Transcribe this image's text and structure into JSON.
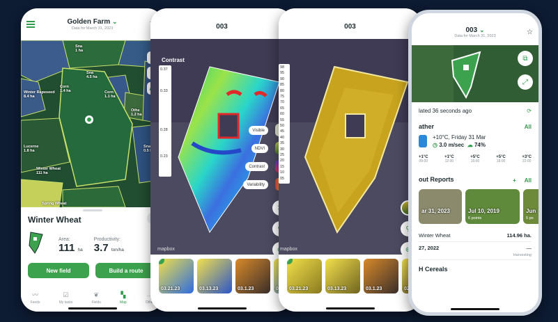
{
  "colors": {
    "accent": "#3da24e",
    "background": "#0d1b33"
  },
  "phone1": {
    "header": {
      "title": "Golden Farm",
      "subtitle": "Data for March 31, 2023"
    },
    "map_buttons": [
      "AR"
    ],
    "fields": [
      {
        "name": "Sna",
        "area": "1 ha"
      },
      {
        "name": "Winter Rapeseed",
        "area": "8.4 ha"
      },
      {
        "name": "Corn",
        "area": "1.1 ha"
      },
      {
        "name": "Corn",
        "area": "1.4 ha"
      },
      {
        "name": "Sna",
        "area": "4.5 ha"
      },
      {
        "name": "Othe",
        "area": "1.2 ha"
      },
      {
        "name": "Sna",
        "area": "0.5 ha"
      },
      {
        "name": "Lucerne",
        "area": "1.8 ha"
      },
      {
        "name": "Winter Wheat",
        "area": "111 ha"
      },
      {
        "name": "Spring Wheat",
        "area": ""
      }
    ],
    "sheet": {
      "crop": "Winter Wheat",
      "area_label": "Area:",
      "area_value": "111",
      "area_unit": "ha",
      "prod_label": "Productivity:",
      "prod_value": "3.7",
      "prod_unit": "ton/ha",
      "btn_new": "New field",
      "btn_route": "Build a route"
    },
    "tabs": [
      {
        "label": "Feeds",
        "icon": "feed-icon"
      },
      {
        "label": "My tasks",
        "icon": "tasks-icon"
      },
      {
        "label": "Fields",
        "icon": "fields-icon"
      },
      {
        "label": "Map",
        "icon": "map-icon"
      },
      {
        "label": "Other",
        "icon": "more-icon"
      }
    ]
  },
  "phone2": {
    "title": "003",
    "overlay_label": "Contrast",
    "legend": [
      "0.37",
      "0.33",
      "0.28",
      "0.23"
    ],
    "controls": [
      "Visible",
      "NDVI",
      "Contrast",
      "Variability"
    ],
    "mapbox": "mapbox",
    "thumbs": [
      "03.21.23",
      "03.13.23",
      "03.1.23",
      "02"
    ]
  },
  "phone3": {
    "title": "003",
    "legend": [
      "98",
      "95",
      "90",
      "85",
      "80",
      "75",
      "70",
      "65",
      "60",
      "55",
      "50",
      "45",
      "40",
      "35",
      "30",
      "25",
      "20",
      "15",
      "10",
      "05"
    ],
    "mapbox": "mapbox",
    "thumbs": [
      "03.21.23",
      "03.13.23",
      "03.1.23",
      "02"
    ]
  },
  "phone4": {
    "header": {
      "title": "003",
      "subtitle": "Data for March 31, 2023"
    },
    "updated": "lated 36 seconds ago",
    "weather": {
      "heading": "ather",
      "all": "All",
      "now": "+10°C, Friday 31 Mar",
      "wind": "3.0 m/sec",
      "humidity": "74%",
      "hours": [
        {
          "t": "+1°C",
          "h": "09:00"
        },
        {
          "t": "+1°C",
          "h": "12:00"
        },
        {
          "t": "+5°C",
          "h": "15:00"
        },
        {
          "t": "+5°C",
          "h": "18:00"
        },
        {
          "t": "+3°C",
          "h": "21:00"
        },
        {
          "t": "+3°C",
          "h": "22:00"
        }
      ]
    },
    "reports": {
      "heading": "out Reports",
      "all": "All",
      "cards": [
        {
          "date": "ar 31, 2023",
          "points": ""
        },
        {
          "date": "Jul 10, 2019",
          "points": "6 points"
        },
        {
          "date": "Jun",
          "points": "5 po"
        }
      ]
    },
    "crop": {
      "name": "Winter Wheat",
      "area": "114.96 ha."
    },
    "task": {
      "date": "27, 2022",
      "value": "—",
      "type": "Harvesting"
    },
    "section": "H Cereals"
  }
}
